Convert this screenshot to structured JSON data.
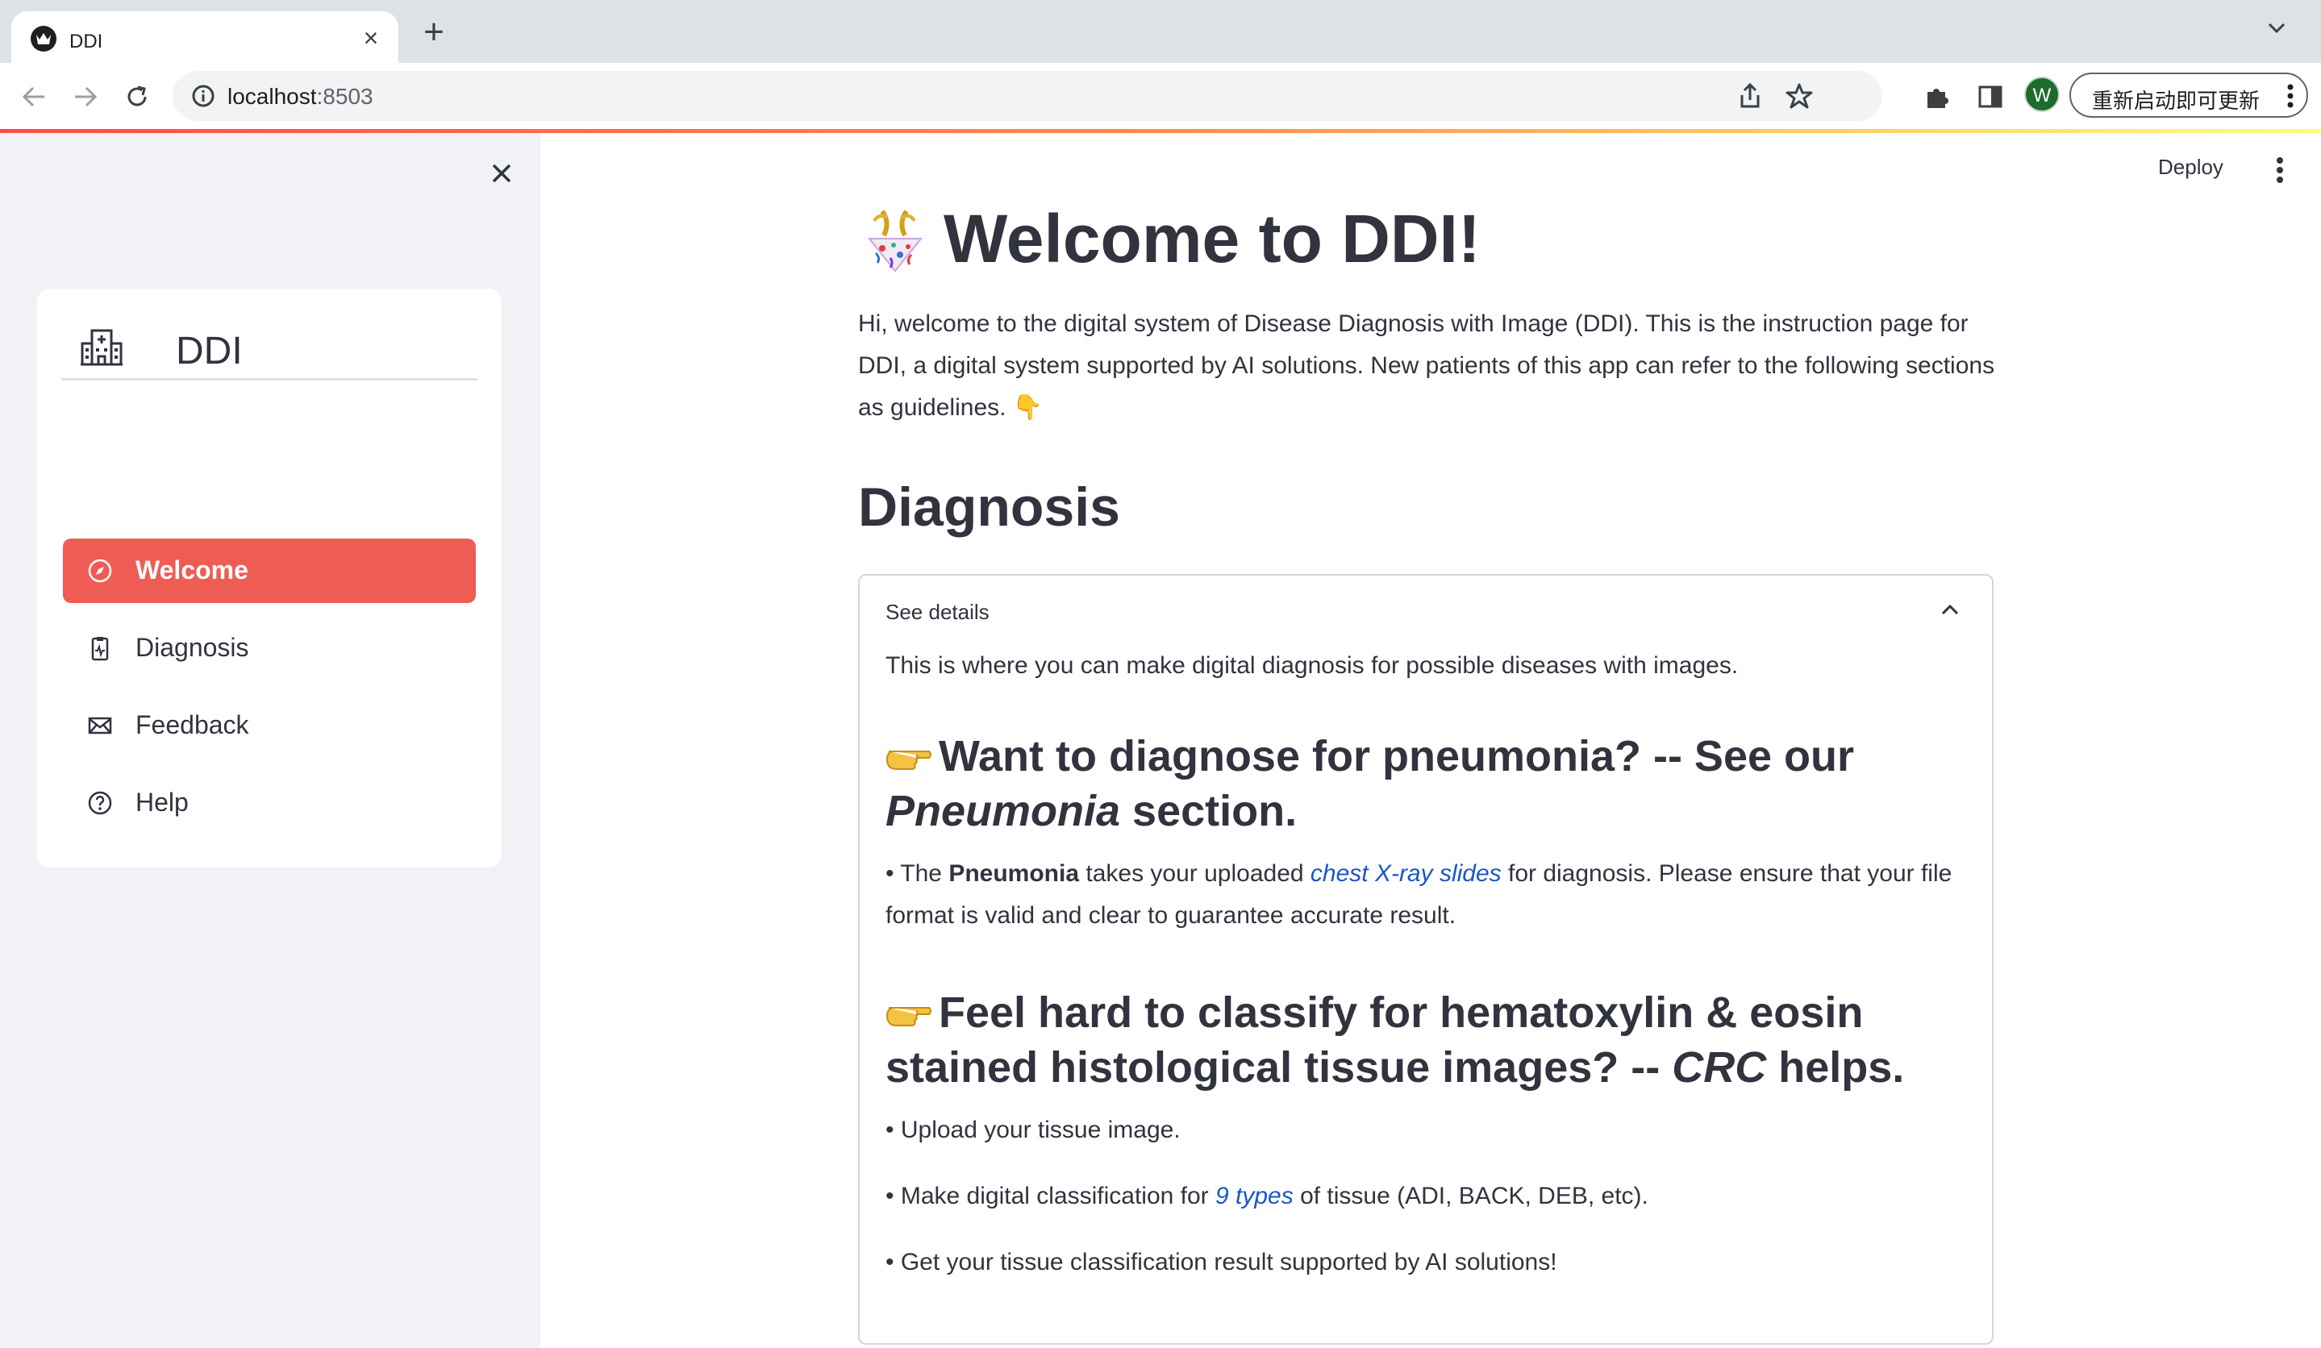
{
  "browser": {
    "tab_title": "DDI",
    "url_host": "localhost",
    "url_port": ":8503",
    "update_button_label": "重新启动即可更新",
    "avatar_letter": "W"
  },
  "app_header": {
    "deploy_label": "Deploy"
  },
  "sidebar": {
    "brand_title": "DDI",
    "items": [
      {
        "label": "Welcome",
        "icon": "compass-icon",
        "active": true
      },
      {
        "label": "Diagnosis",
        "icon": "clipboard-pulse-icon",
        "active": false
      },
      {
        "label": "Feedback",
        "icon": "envelope-icon",
        "active": false
      },
      {
        "label": "Help",
        "icon": "question-circle-icon",
        "active": false
      }
    ]
  },
  "main": {
    "title": "Welcome to DDI!",
    "title_emoji": "confetti-icon",
    "intro": "Hi, welcome to the digital system of Disease Diagnosis with Image (DDI). This is the instruction page for DDI, a digital system supported by AI solutions. New patients of this app can refer to the following sections as guidelines. 👇",
    "section_title": "Diagnosis",
    "expander": {
      "summary": "See details",
      "expanded": true,
      "lead": "This is where you can make digital diagnosis for possible diseases with images.",
      "pneumonia": {
        "heading_before": "Want to diagnose for pneumonia? -- See our ",
        "heading_em": "Pneumonia",
        "heading_after": " section.",
        "bullet_prefix": "• The ",
        "bullet_bold": "Pneumonia",
        "bullet_mid": " takes your uploaded ",
        "bullet_link": "chest X-ray slides",
        "bullet_after": " for diagnosis. Please ensure that your file format is valid and clear to guarantee accurate result."
      },
      "crc": {
        "heading_before": "Feel hard to classify for hematoxylin & eosin stained histological tissue images? -- ",
        "heading_em": "CRC",
        "heading_after": " helps.",
        "bullet1": "• Upload your tissue image.",
        "bullet2_before": "• Make digital classification for ",
        "bullet2_link": "9 types",
        "bullet2_after": " of tissue (ADI, BACK, DEB, etc).",
        "bullet3": "• Get your tissue classification result supported by AI solutions!"
      }
    }
  },
  "colors": {
    "accent": "#ef5c54",
    "link": "#1a56c9",
    "sidebar_bg": "#f0f2f6",
    "text": "#31333f"
  }
}
